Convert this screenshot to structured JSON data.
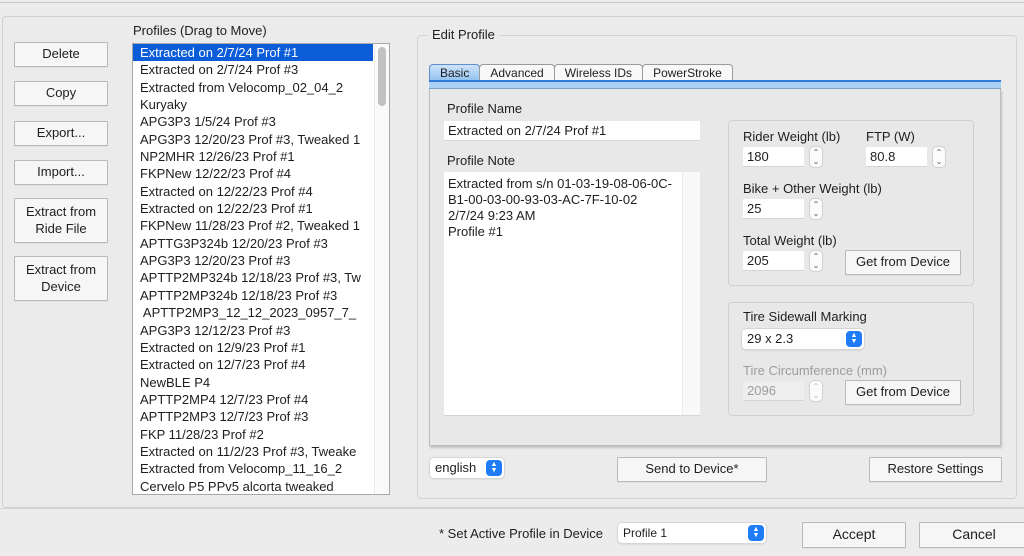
{
  "side_buttons": {
    "delete": "Delete",
    "copy": "Copy",
    "export": "Export...",
    "import": "Import...",
    "extract_ride": "Extract from\nRide File",
    "extract_device": "Extract from\nDevice"
  },
  "profiles": {
    "label": "Profiles (Drag to Move)",
    "selected_index": 0,
    "items": [
      "Extracted on 2/7/24 Prof #1",
      "Extracted on 2/7/24 Prof #3",
      "Extracted from Velocomp_02_04_2",
      "Kuryaky",
      "APG3P3 1/5/24 Prof #3",
      "APG3P3 12/20/23 Prof #3, Tweaked 1",
      "NP2MHR 12/26/23 Prof #1",
      "FKPNew 12/22/23 Prof #4",
      "Extracted on 12/22/23 Prof #4",
      "Extracted on 12/22/23 Prof #1",
      "FKPNew 11/28/23 Prof #2, Tweaked 1",
      "APTTG3P324b 12/20/23 Prof #3",
      "APG3P3 12/20/23 Prof #3",
      "APTTP2MP324b 12/18/23 Prof #3, Tw",
      "APTTP2MP324b 12/18/23 Prof #3",
      " APTTP2MP3_12_12_2023_0957_7_",
      "APG3P3 12/12/23 Prof #3",
      "Extracted on 12/9/23 Prof #1",
      "Extracted on 12/7/23 Prof #4",
      "NewBLE P4",
      "APTTP2MP4 12/7/23 Prof #4",
      "APTTP2MP3 12/7/23 Prof #3",
      "FKP 11/28/23 Prof #2",
      "Extracted on 11/2/23 Prof #3, Tweake",
      "Extracted from Velocomp_11_16_2",
      "Cervelo P5 PPv5 alcorta tweaked"
    ]
  },
  "edit_profile": {
    "title": "Edit Profile",
    "tabs": [
      "Basic",
      "Advanced",
      "Wireless IDs",
      "PowerStroke"
    ],
    "active_tab": "Basic",
    "profile_name_label": "Profile Name",
    "profile_name_value": "Extracted on 2/7/24 Prof #1",
    "profile_note_label": "Profile Note",
    "profile_note_value": "Extracted from s/n 01-03-19-08-06-0C-B1-00-03-00-93-03-AC-7F-10-02\n2/7/24 9:23 AM\nProfile #1",
    "rider_weight_label": "Rider Weight (lb)",
    "rider_weight_value": "180",
    "ftp_label": "FTP (W)",
    "ftp_value": "80.8",
    "bike_weight_label": "Bike + Other Weight (lb)",
    "bike_weight_value": "25",
    "total_weight_label": "Total Weight (lb)",
    "total_weight_value": "205",
    "get_from_device_label": "Get from Device",
    "tire_marking_label": "Tire Sidewall Marking",
    "tire_marking_value": "29 x 2.3",
    "tire_circ_label": "Tire Circumference (mm)",
    "tire_circ_value": "2096",
    "language_value": "english",
    "send_to_device_label": "Send to Device*",
    "restore_settings_label": "Restore Settings"
  },
  "footer": {
    "active_profile_label": "* Set Active Profile in Device",
    "active_profile_value": "Profile 1",
    "accept_label": "Accept",
    "cancel_label": "Cancel"
  },
  "colors": {
    "selection": "#0a5cd8",
    "accent": "#1f7cf5"
  }
}
